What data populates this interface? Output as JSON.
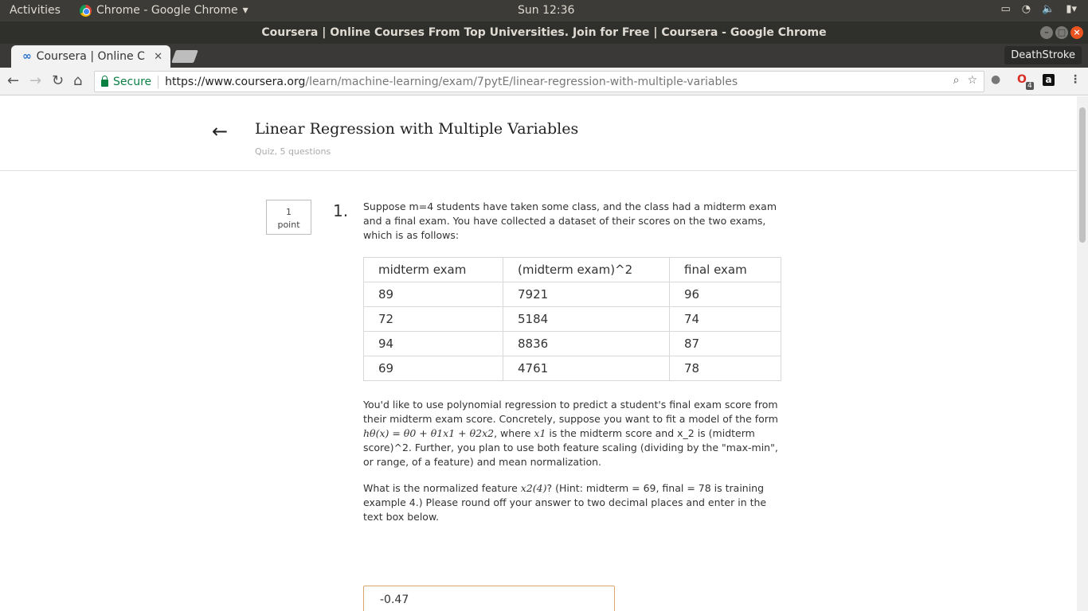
{
  "system": {
    "activities": "Activities",
    "app_menu": "Chrome - Google Chrome",
    "clock": "Sun 12:36"
  },
  "window": {
    "title": "Coursera | Online Courses From Top Universities. Join for Free | Coursera - Google Chrome"
  },
  "tabs": [
    {
      "title": "Coursera | Online C"
    }
  ],
  "profile": "DeathStroke",
  "address": {
    "secure_label": "Secure",
    "url_host": "https://www.coursera.org",
    "url_path": "/learn/machine-learning/exam/7pytE/linear-regression-with-multiple-variables"
  },
  "extensions": {
    "badge_count": "4"
  },
  "quiz": {
    "title": "Linear Regression with Multiple Variables",
    "subtitle": "Quiz, 5 questions"
  },
  "question": {
    "points_value": "1",
    "points_label": "point",
    "number": "1.",
    "intro": "Suppose m=4 students have taken some class, and the class had a midterm exam and a final exam. You have collected a dataset of their scores on the two exams, which is as follows:",
    "table": {
      "headers": [
        "midterm exam",
        "(midterm exam)^2",
        "final exam"
      ],
      "rows": [
        [
          "89",
          "7921",
          "96"
        ],
        [
          "72",
          "5184",
          "74"
        ],
        [
          "94",
          "8836",
          "87"
        ],
        [
          "69",
          "4761",
          "78"
        ]
      ]
    },
    "para2_a": "You'd like to use polynomial regression to predict a student's final exam score from their midterm exam score. Concretely, suppose you want to fit a model of the form ",
    "formula": "hθ(x) = θ0 + θ1x1 + θ2x2",
    "para2_b": ", where ",
    "x1": "x1",
    "para2_c": " is the midterm score and x_2 is (midterm score)^2. Further, you plan to use both feature scaling (dividing by the \"max-min\", or range, of a feature) and mean normalization.",
    "para3_a": "What is the normalized feature ",
    "feature": "x2(4)",
    "para3_b": "? (Hint: midterm = 69, final = 78 is training example 4.) Please round off your answer to two decimal places and enter in the text box below.",
    "answer": "-0.47"
  }
}
